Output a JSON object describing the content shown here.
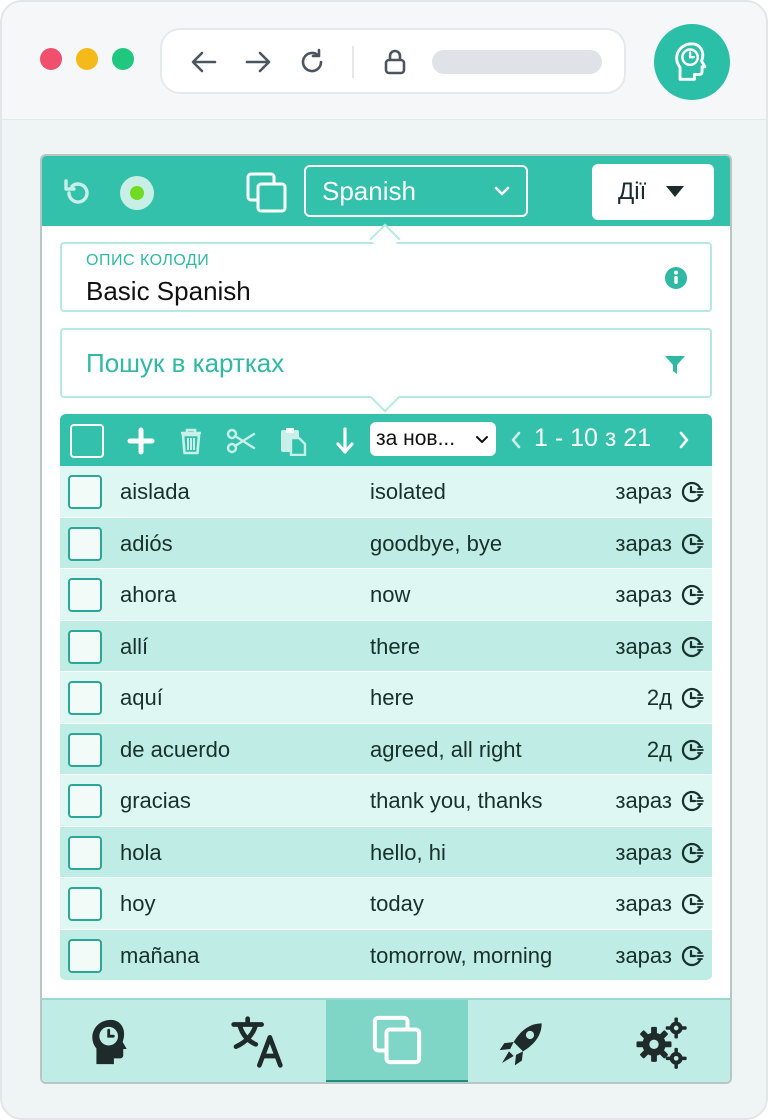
{
  "app": {
    "deck_selector": {
      "value": "Spanish"
    },
    "actions_button": {
      "label": "Дії"
    },
    "deck_description": {
      "label": "ОПИС КОЛОДИ",
      "value": "Basic Spanish"
    },
    "search": {
      "placeholder": "Пошук в картках"
    },
    "toolbar": {
      "sort": {
        "value": "за нов..."
      },
      "pagination": "1 - 10 з 21"
    },
    "cards": [
      {
        "term": "aislada",
        "definition": "isolated",
        "due": "зараз"
      },
      {
        "term": "adiós",
        "definition": "goodbye, bye",
        "due": "зараз"
      },
      {
        "term": "ahora",
        "definition": "now",
        "due": "зараз"
      },
      {
        "term": "allí",
        "definition": "there",
        "due": "зараз"
      },
      {
        "term": "aquí",
        "definition": "here",
        "due": "2д"
      },
      {
        "term": "de acuerdo",
        "definition": "agreed, all right",
        "due": "2д"
      },
      {
        "term": "gracias",
        "definition": "thank you, thanks",
        "due": "зараз"
      },
      {
        "term": "hola",
        "definition": "hello, hi",
        "due": "зараз"
      },
      {
        "term": "hoy",
        "definition": "today",
        "due": "зараз"
      },
      {
        "term": "mañana",
        "definition": "tomorrow, morning",
        "due": "зараз"
      }
    ],
    "bottom_nav": {
      "items": [
        {
          "icon": "head-clock-icon",
          "active": false
        },
        {
          "icon": "translate-icon",
          "active": false
        },
        {
          "icon": "cards-icon",
          "active": true
        },
        {
          "icon": "rocket-icon",
          "active": false
        },
        {
          "icon": "gears-icon",
          "active": false
        }
      ]
    }
  },
  "colors": {
    "accent": "#33c1ab",
    "accent_dark": "#1a8f80",
    "row_light": "#dff7f2",
    "row_dark": "#bfece4",
    "record_dot": "#6fdc22",
    "mac_red": "#f0506e",
    "mac_yellow": "#f6b91a",
    "mac_green": "#20c77f"
  }
}
